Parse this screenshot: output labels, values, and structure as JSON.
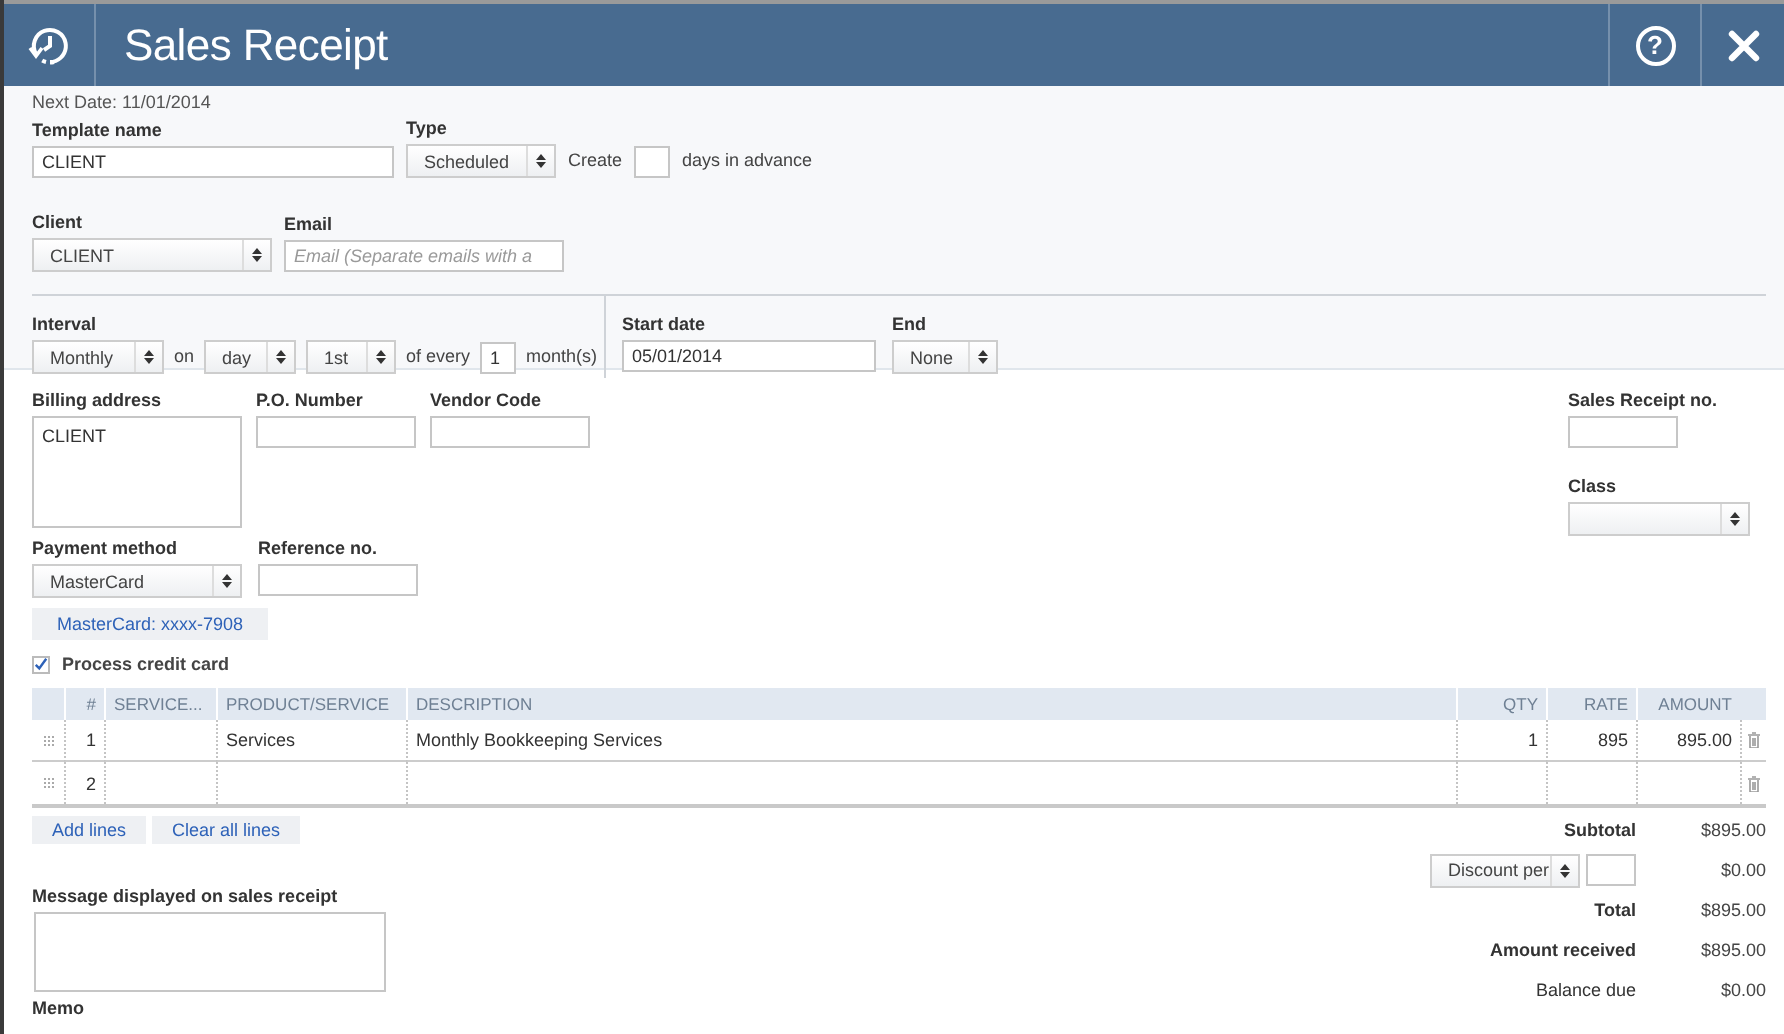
{
  "header": {
    "title": "Sales Receipt",
    "help_symbol": "?"
  },
  "schedule": {
    "next_date": "Next Date: 11/01/2014",
    "template_name": {
      "label": "Template name",
      "value": "CLIENT"
    },
    "type": {
      "label": "Type",
      "value": "Scheduled"
    },
    "create_text": "Create",
    "advance_text": "days in advance",
    "client": {
      "label": "Client",
      "value": "CLIENT"
    },
    "email": {
      "label": "Email",
      "placeholder": "Email (Separate emails with a"
    },
    "interval": {
      "label": "Interval",
      "value": "Monthly"
    },
    "on_text": "on",
    "day_unit": "day",
    "day": "1st",
    "of_every_text": "of every",
    "every": "1",
    "months_text": "month(s)",
    "start_date": {
      "label": "Start date",
      "value": "05/01/2014"
    },
    "end": {
      "label": "End",
      "value": "None"
    }
  },
  "details": {
    "billing_address": {
      "label": "Billing address",
      "value": "CLIENT"
    },
    "po_number": {
      "label": "P.O. Number"
    },
    "vendor_code": {
      "label": "Vendor Code"
    },
    "sales_receipt_no": {
      "label": "Sales Receipt no."
    },
    "class": {
      "label": "Class"
    },
    "payment_method": {
      "label": "Payment method",
      "value": "MasterCard"
    },
    "reference_no": {
      "label": "Reference no."
    },
    "card_button": "MasterCard: xxxx-7908",
    "process_credit_card": {
      "label": "Process credit card",
      "checked": true
    }
  },
  "table": {
    "columns": [
      "#",
      "SERVICE...",
      "PRODUCT/SERVICE",
      "DESCRIPTION",
      "QTY",
      "RATE",
      "AMOUNT"
    ],
    "rows": [
      {
        "number": "1",
        "product_service": "Services",
        "description": "Monthly Bookkeeping Services",
        "qty": "1",
        "rate": "895",
        "amount": "895.00"
      },
      {
        "number": "2"
      }
    ]
  },
  "table_actions": [
    "Add lines",
    "Clear all lines"
  ],
  "totals": [
    {
      "kind": "line",
      "label": "Subtotal",
      "value": "$895.00",
      "bold": true
    },
    {
      "kind": "discount",
      "select": "Discount per",
      "value": "$0.00"
    },
    {
      "kind": "line",
      "label": "Total",
      "value": "$895.00",
      "bold": true
    },
    {
      "kind": "line",
      "label": "Amount received",
      "value": "$895.00",
      "bold": true
    },
    {
      "kind": "line",
      "label": "Balance due",
      "value": "$0.00",
      "bold": false
    }
  ],
  "message": {
    "label": "Message displayed on sales receipt"
  },
  "memo": {
    "label": "Memo"
  }
}
